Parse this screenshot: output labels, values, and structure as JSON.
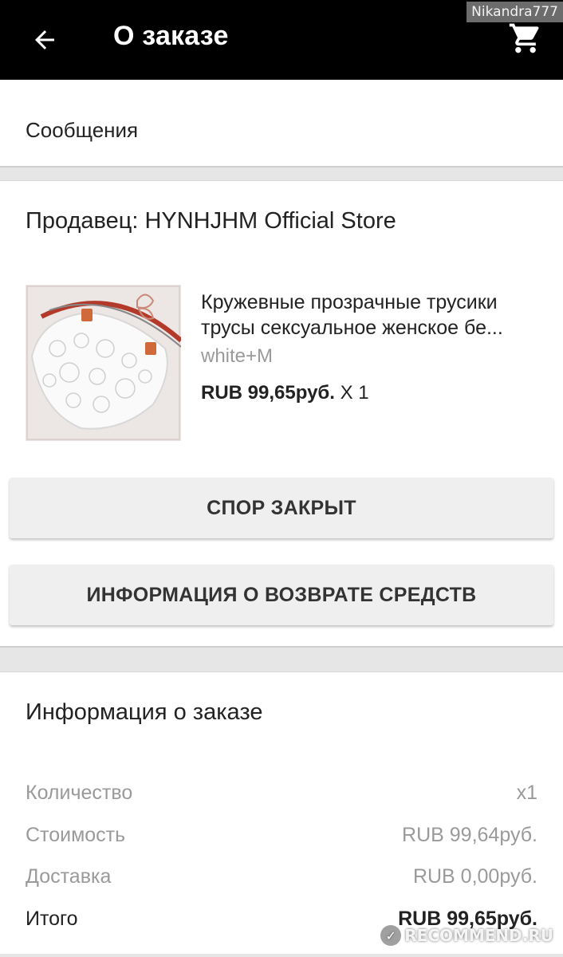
{
  "header": {
    "title": "О заказе",
    "back_icon": "arrow-left-icon",
    "cart_icon": "cart-icon",
    "background": "#000000"
  },
  "watermark_user": "Nikandra777",
  "messages": {
    "label": "Сообщения"
  },
  "order": {
    "seller": "Продавец: HYNHJHM Official Store",
    "product": {
      "title_line1": "Кружевные прозрачные трусики",
      "title_line2": "трусы сексуальное женское бе...",
      "variant": "white+M",
      "price": "RUB 99,65руб.",
      "quantity": "X 1"
    },
    "buttons": {
      "dispute": "СПОР ЗАКРЫТ",
      "refund": "ИНФОРМАЦИЯ О ВОЗВРАТЕ СРЕДСТВ"
    }
  },
  "info": {
    "title": "Информация о заказе",
    "rows": [
      {
        "label": "Количество",
        "value": "x1"
      },
      {
        "label": "Стоимость",
        "value": "RUB 99,64руб."
      },
      {
        "label": "Доставка",
        "value": "RUB 0,00руб."
      },
      {
        "label": "Итого",
        "value": "RUB 99,65руб."
      }
    ]
  },
  "watermark_site": "RECOMMEND.RU"
}
